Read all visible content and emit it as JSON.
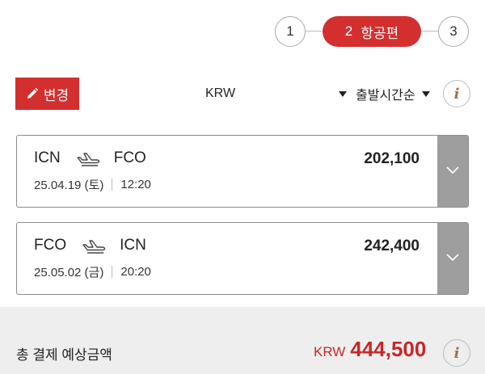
{
  "stepper": {
    "step1": "1",
    "step2_number": "2",
    "step2_label": "항공편",
    "step3": "3"
  },
  "toolbar": {
    "change_label": "변경",
    "currency": "KRW",
    "sort": "출발시간순",
    "info_glyph": "i"
  },
  "flights": [
    {
      "from": "ICN",
      "to": "FCO",
      "date": "25.04.19 (토)",
      "time": "12:20",
      "price": "202,100",
      "icon": "airplane-departure-icon"
    },
    {
      "from": "FCO",
      "to": "ICN",
      "date": "25.05.02 (금)",
      "time": "20:20",
      "price": "242,400",
      "icon": "airplane-departure-icon"
    }
  ],
  "total": {
    "label": "총 결제 예상금액",
    "currency": "KRW",
    "amount": "444,500",
    "info_glyph": "i"
  },
  "colors": {
    "accent": "#d32f2f",
    "expand_bar": "#9e9e9e",
    "footer_bg": "#eeeeee",
    "info_icon": "#a0724a"
  }
}
